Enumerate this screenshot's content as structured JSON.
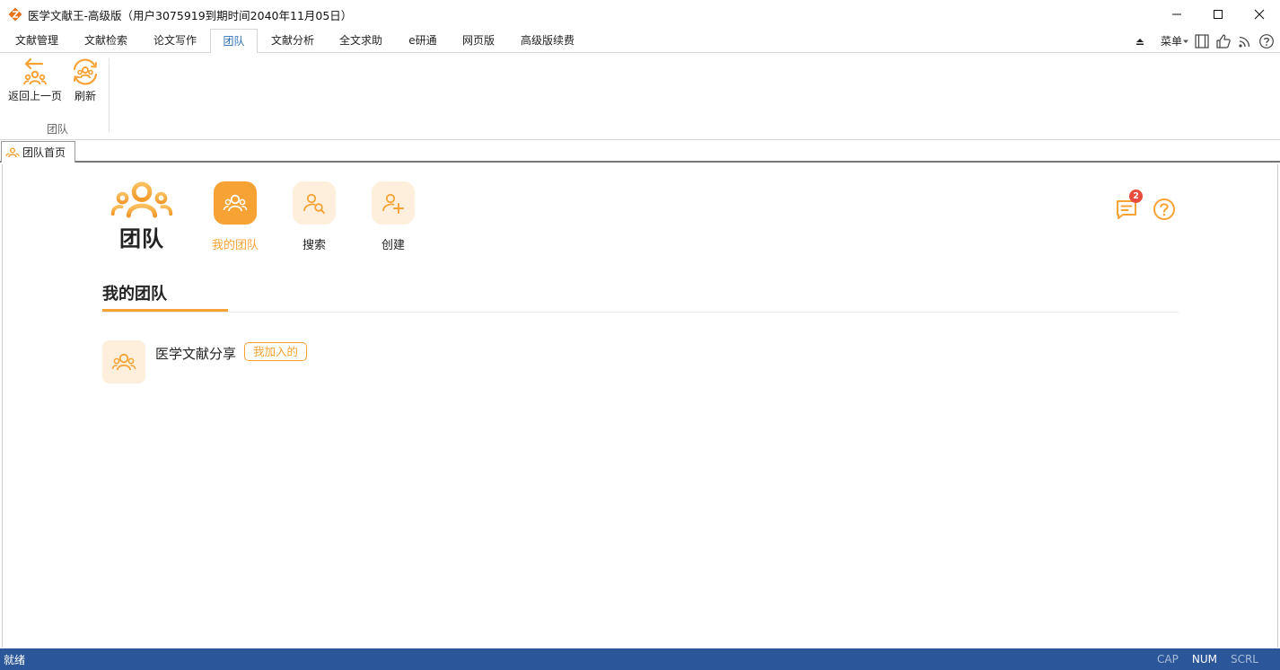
{
  "window": {
    "title": "医学文献王-高级版（用户3075919到期时间2040年11月05日）",
    "logo_icon": "app-logo-icon",
    "controls": [
      "minimize-icon",
      "maximize-icon",
      "close-icon"
    ]
  },
  "menubar": {
    "tabs": [
      "文献管理",
      "文献检索",
      "论文写作",
      "团队",
      "文献分析",
      "全文求助",
      "e研通",
      "网页版",
      "高级版续费"
    ],
    "active_tab": "团队",
    "menu_label": "菜单",
    "right_icons": [
      "collapse-ribbon-icon",
      "layout-icon",
      "like-icon",
      "rss-icon",
      "help-icon"
    ]
  },
  "ribbon": {
    "buttons": [
      {
        "label": "返回上一页",
        "icon": "back-team-icon"
      },
      {
        "label": "刷新",
        "icon": "refresh-team-icon"
      }
    ],
    "group_label": "团队"
  },
  "doctabs": {
    "tabs": [
      {
        "label": "团队首页",
        "icon": "team-icon"
      }
    ]
  },
  "team_page": {
    "logo_title": "团队",
    "nav": [
      {
        "label": "我的团队",
        "icon": "my-team-icon",
        "active": true
      },
      {
        "label": "搜索",
        "icon": "search-team-icon",
        "active": false
      },
      {
        "label": "创建",
        "icon": "create-team-icon",
        "active": false
      }
    ],
    "messages_badge": "2",
    "section_title": "我的团队",
    "teams": [
      {
        "name": "医学文献分享",
        "tag": "我加入的"
      }
    ]
  },
  "statusbar": {
    "text": "就绪",
    "keys": [
      {
        "label": "CAP",
        "on": false
      },
      {
        "label": "NUM",
        "on": true
      },
      {
        "label": "SCRL",
        "on": false
      }
    ]
  },
  "colors": {
    "accent": "#f7a234",
    "accent_light": "#fdefdc",
    "active_tab_text": "#2f6fb7",
    "statusbar": "#2b579a",
    "badge": "#e74c3c"
  }
}
